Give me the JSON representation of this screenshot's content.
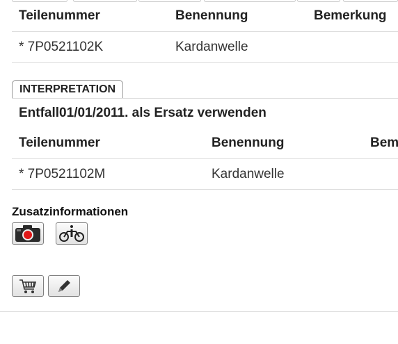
{
  "table1": {
    "headers": [
      "Teilenummer",
      "Benennung",
      "Bemerkung"
    ],
    "rows": [
      [
        "* 7P0521102K",
        "Kardanwelle",
        ""
      ]
    ]
  },
  "interpretation": {
    "tab_label": "INTERPRETATION",
    "text": "Entfall01/01/2011. als Ersatz verwenden"
  },
  "table2": {
    "headers": [
      "Teilenummer",
      "Benennung",
      "Bemerkung"
    ],
    "rows": [
      [
        "* 7P0521102M",
        "Kardanwelle",
        ""
      ]
    ]
  },
  "zusatz": {
    "title": "Zusatzinformationen",
    "icons": [
      "camera-icon",
      "info-motorbike-icon"
    ]
  },
  "actions": {
    "icons": [
      "cart-icon",
      "pencil-icon"
    ]
  }
}
